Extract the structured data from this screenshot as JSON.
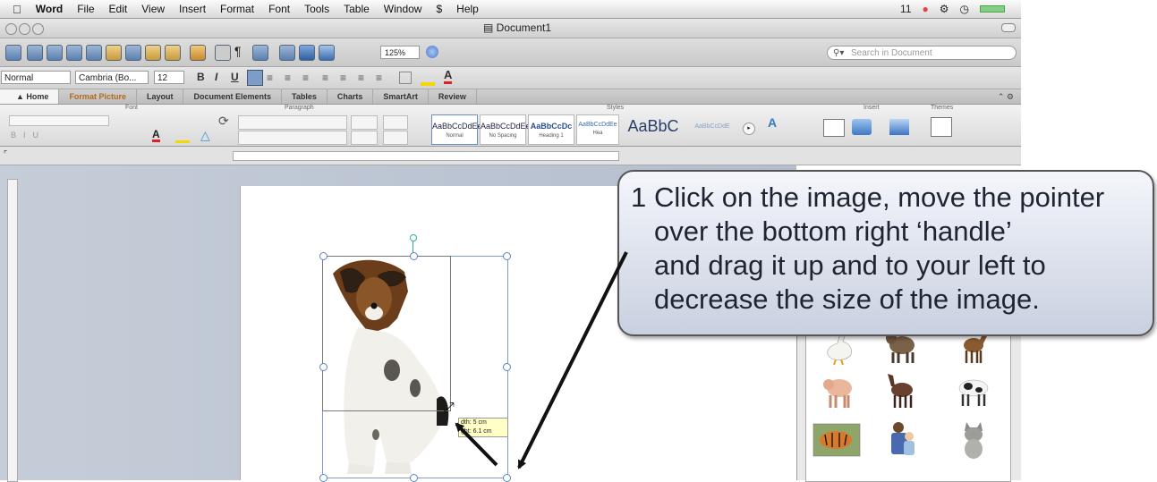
{
  "menubar": {
    "apple": "",
    "items": [
      "Word",
      "File",
      "Edit",
      "View",
      "Insert",
      "Format",
      "Font",
      "Tools",
      "Table",
      "Window",
      "Help"
    ],
    "script_icon": "$",
    "right_status": "11"
  },
  "window": {
    "title": "Document1"
  },
  "toolbar": {
    "zoom": "125%",
    "search_placeholder": "Search in Document"
  },
  "formatbar": {
    "style": "Normal",
    "font": "Cambria (Bo...",
    "size": "12",
    "bold": "B",
    "italic": "I",
    "underline": "U"
  },
  "ribbon_tabs": [
    "Home",
    "Format Picture",
    "Layout",
    "Document Elements",
    "Tables",
    "Charts",
    "SmartArt",
    "Review"
  ],
  "ribbon": {
    "groups": [
      "Font",
      "Paragraph",
      "Styles",
      "Insert",
      "Themes"
    ],
    "styles": [
      {
        "sample": "AaBbCcDdEe",
        "name": "Normal"
      },
      {
        "sample": "AaBbCcDdEe",
        "name": "No Spacing"
      },
      {
        "sample": "AaBbCcDc",
        "name": "Heading 1"
      },
      {
        "sample": "AaBbCcDdEe",
        "name": "Hea"
      },
      {
        "sample": "AaBbC",
        "name": ""
      },
      {
        "sample": "AaBbCcDdE",
        "name": ""
      }
    ]
  },
  "image_tooltip": {
    "line1": "dth: 5 cm",
    "line2": "ght: 6.1 cm"
  },
  "callout": {
    "number": "1",
    "line1": "Click on the image, move the pointer",
    "line2": "over the bottom right ‘handle’",
    "line3": "and drag it up and to your left to",
    "line4": "decrease the size of the image."
  },
  "clipart": [
    "goose-clip",
    "goat-clip",
    "horse-clip",
    "pig-clip",
    "donkey-clip",
    "cow-clip",
    "tiger-clip",
    "family-clip",
    "kitten-clip"
  ]
}
